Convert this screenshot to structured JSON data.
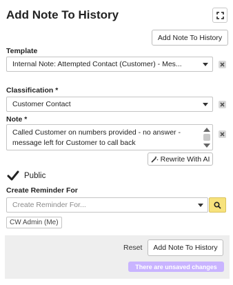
{
  "header": {
    "title": "Add Note To History",
    "expand_icon": "expand-icon",
    "top_button_label": "Add Note To History"
  },
  "template": {
    "label": "Template",
    "value": "Internal Note: Attempted Contact (Customer) - Mes..."
  },
  "classification": {
    "label": "Classification *",
    "value": "Customer Contact"
  },
  "note": {
    "label": "Note *",
    "value": "Called Customer on numbers provided - no answer - message left for Customer to call back",
    "rewrite_label": "Rewrite With AI",
    "rewrite_icon": "magic-wand-icon"
  },
  "public": {
    "label": "Public",
    "checked": true
  },
  "reminder": {
    "label": "Create Reminder For",
    "placeholder": "Create Reminder For...",
    "search_icon": "search-icon",
    "selected_chip": "CW Admin (Me)"
  },
  "footer": {
    "reset_label": "Reset",
    "submit_label": "Add Note To History",
    "unsaved_text": "There are unsaved changes"
  },
  "colors": {
    "search_button": "#f7e27c",
    "unsaved_badge": "#c9b4ff",
    "footer_bg": "#eeeeee"
  }
}
